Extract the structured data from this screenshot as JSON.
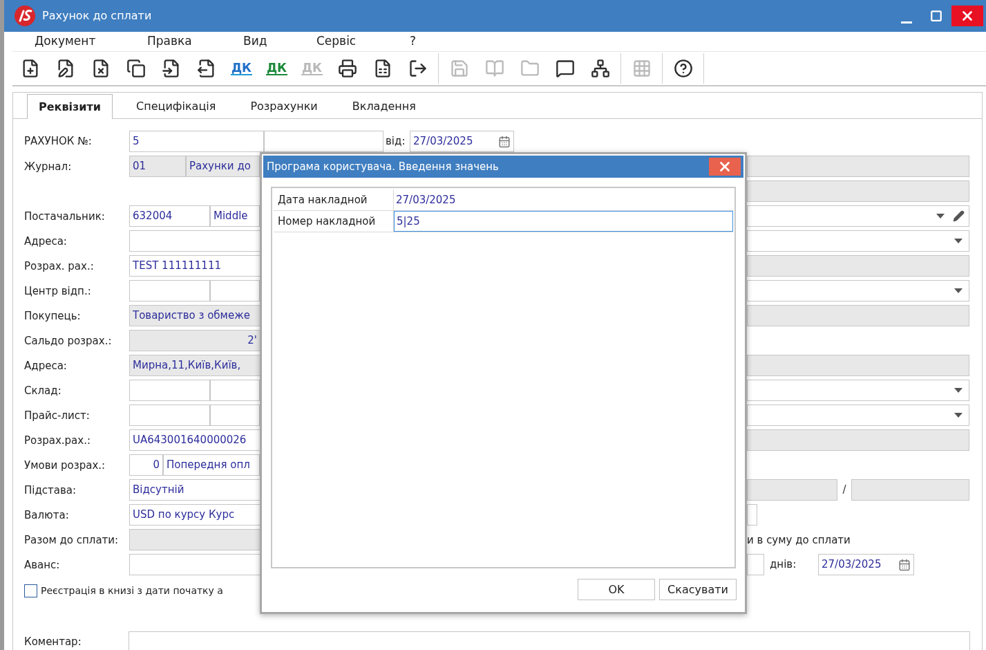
{
  "window": {
    "title": "Рахунок до сплати"
  },
  "menu": [
    "Документ",
    "Правка",
    "Вид",
    "Сервіс",
    "?"
  ],
  "toolbar": [
    {
      "kind": "new",
      "disabled": false
    },
    {
      "kind": "edit",
      "disabled": false
    },
    {
      "kind": "delete",
      "disabled": false
    },
    {
      "kind": "copy",
      "disabled": false
    },
    {
      "kind": "import",
      "disabled": false
    },
    {
      "kind": "export",
      "disabled": false
    },
    {
      "kind": "dk-blue",
      "label": "ДК",
      "disabled": false
    },
    {
      "kind": "dk-green",
      "label": "ДК",
      "disabled": false
    },
    {
      "kind": "dk-gray",
      "label": "ДК",
      "disabled": true
    },
    {
      "kind": "print",
      "disabled": false
    },
    {
      "kind": "excel",
      "disabled": false
    },
    {
      "kind": "exit",
      "disabled": false
    },
    {
      "kind": "save",
      "disabled": true,
      "group": true
    },
    {
      "kind": "book",
      "disabled": true
    },
    {
      "kind": "folder",
      "disabled": true
    },
    {
      "kind": "user",
      "disabled": false
    },
    {
      "kind": "tree",
      "disabled": false
    },
    {
      "kind": "grid",
      "disabled": true,
      "group": true
    },
    {
      "kind": "help",
      "disabled": false,
      "group": true
    }
  ],
  "tabs": [
    {
      "label": "Реквізити",
      "selected": true
    },
    {
      "label": "Специфікація",
      "selected": false
    },
    {
      "label": "Розрахунки",
      "selected": false
    },
    {
      "label": "Вкладення",
      "selected": false
    }
  ],
  "invoice": {
    "label": "РАХУНОК №:",
    "number": "5",
    "date_label": "від:",
    "date": "27/03/2025"
  },
  "rows": [
    {
      "label": "Журнал:",
      "kind": "journal",
      "left": [
        {
          "value": "01",
          "readonly": true
        },
        {
          "value": "Рахунки до",
          "readonly": true
        }
      ],
      "right": {
        "kind": "readonly"
      }
    },
    {
      "right": {
        "kind": "readonly"
      }
    },
    {
      "label": "Постачальник:",
      "kind": "pair",
      "left": [
        {
          "value": "632004",
          "readonly": false
        },
        {
          "value": "Middle",
          "readonly": false
        }
      ],
      "right": {
        "kind": "select-edit"
      }
    },
    {
      "label": "Адреса:",
      "kind": "single",
      "left": [
        {
          "readonly": false
        }
      ],
      "right": {
        "kind": "select"
      }
    },
    {
      "label": "Розрах. рах.:",
      "kind": "single",
      "left": [
        {
          "value": "TEST 111111111",
          "readonly": false
        }
      ],
      "right": {
        "kind": "readonly"
      }
    },
    {
      "label": "Центр відп.:",
      "kind": "pair",
      "left": [
        {
          "readonly": false
        },
        {
          "readonly": false
        }
      ],
      "right": {
        "kind": "select"
      }
    },
    {
      "label": "Покупець:",
      "kind": "single",
      "left": [
        {
          "value": "Товариство з обмеже",
          "readonly": true
        }
      ],
      "right": {
        "kind": "readonly"
      }
    },
    {
      "label": "Сальдо розрах.:",
      "kind": "amount",
      "left": [
        {
          "value": "2'",
          "readonly": true
        }
      ],
      "right": {
        "kind": "none"
      }
    },
    {
      "label": "Адреса:",
      "kind": "single",
      "left": [
        {
          "value": "Мирна,11,Київ,Київ,",
          "readonly": true
        }
      ],
      "right": {
        "kind": "readonly"
      }
    },
    {
      "label": "Склад:",
      "kind": "pair",
      "left": [
        {
          "readonly": false
        },
        {
          "readonly": false
        }
      ],
      "right": {
        "kind": "select"
      }
    },
    {
      "label": "Прайс-лист:",
      "kind": "pair",
      "left": [
        {
          "readonly": false
        },
        {
          "readonly": false
        }
      ],
      "right": {
        "kind": "select"
      }
    },
    {
      "label": "Розрах.рах.:",
      "kind": "single",
      "left": [
        {
          "value": "UA643001640000026",
          "readonly": false
        }
      ],
      "right": {
        "kind": "readonly"
      }
    },
    {
      "label": "Умови розрах.:",
      "kind": "terms",
      "left": [
        {
          "value": "0",
          "readonly": false
        },
        {
          "value": "Попередня опл",
          "readonly": false
        }
      ],
      "right": {
        "kind": "none"
      }
    },
    {
      "label": "Підстава:",
      "kind": "single",
      "left": [
        {
          "value": "Відсутній",
          "readonly": false
        }
      ],
      "right": {
        "kind": "split",
        "separator": "/"
      }
    },
    {
      "label": "Валюта:",
      "kind": "single",
      "left": [
        {
          "value": "USD по курсу Курс",
          "readonly": false
        }
      ],
      "right": {
        "kind": "stub"
      }
    },
    {
      "label": "Разом до сплати:",
      "kind": "single",
      "left": [
        {
          "readonly": true
        }
      ],
      "right": {
        "kind": "text",
        "text": "и в суму до сплати"
      }
    },
    {
      "label": "Аванс:",
      "kind": "single",
      "left": [
        {
          "readonly": false
        }
      ],
      "right": {
        "kind": "days",
        "text": "днів:",
        "date": "27/03/2025"
      }
    }
  ],
  "checkbox": {
    "label": "Реєстрація в книзі з дати початку а",
    "checked": false
  },
  "comment": {
    "label": "Коментар:"
  },
  "dialog": {
    "title": "Програма користувача. Введення значень",
    "fields": [
      {
        "label": "Дата накладной",
        "value": "27/03/2025",
        "selected": false
      },
      {
        "label": "Номер накладной",
        "value": "5|25",
        "selected": true
      }
    ],
    "buttons": [
      "OK",
      "Скасувати"
    ]
  }
}
